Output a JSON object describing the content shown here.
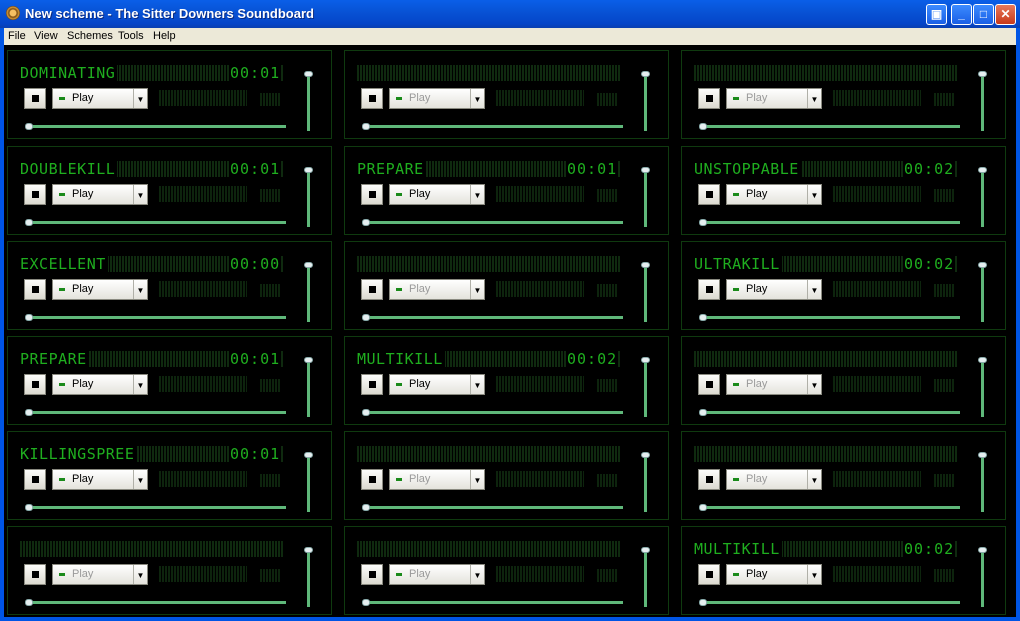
{
  "window": {
    "title": "New scheme - The Sitter Downers Soundboard"
  },
  "menu": [
    "File",
    "View",
    "Schemes",
    "Tools",
    "Help"
  ],
  "panels": [
    {
      "name": "DOMINATING",
      "time": "00:01",
      "enabled": true
    },
    {
      "name": "",
      "time": "",
      "enabled": false
    },
    {
      "name": "",
      "time": "",
      "enabled": false
    },
    {
      "name": "DOUBLEKILL",
      "time": "00:01",
      "enabled": true
    },
    {
      "name": "PREPARE",
      "time": "00:01",
      "enabled": true
    },
    {
      "name": "UNSTOPPABLE",
      "time": "00:02",
      "enabled": true
    },
    {
      "name": "EXCELLENT",
      "time": "00:00",
      "enabled": true
    },
    {
      "name": "",
      "time": "",
      "enabled": false
    },
    {
      "name": "ULTRAKILL",
      "time": "00:02",
      "enabled": true
    },
    {
      "name": "PREPARE",
      "time": "00:01",
      "enabled": true
    },
    {
      "name": "MULTIKILL",
      "time": "00:02",
      "enabled": true
    },
    {
      "name": "",
      "time": "",
      "enabled": false
    },
    {
      "name": "KILLINGSPREE",
      "time": "00:01",
      "enabled": true
    },
    {
      "name": "",
      "time": "",
      "enabled": false
    },
    {
      "name": "",
      "time": "",
      "enabled": false
    },
    {
      "name": "",
      "time": "",
      "enabled": false
    },
    {
      "name": "",
      "time": "",
      "enabled": false
    },
    {
      "name": "MULTIKILL",
      "time": "00:02",
      "enabled": true
    }
  ],
  "play_label": "Play",
  "colors": {
    "lcd_text": "#1fae1f",
    "slider": "#5fb87a",
    "titlebar": "#0853d6"
  }
}
